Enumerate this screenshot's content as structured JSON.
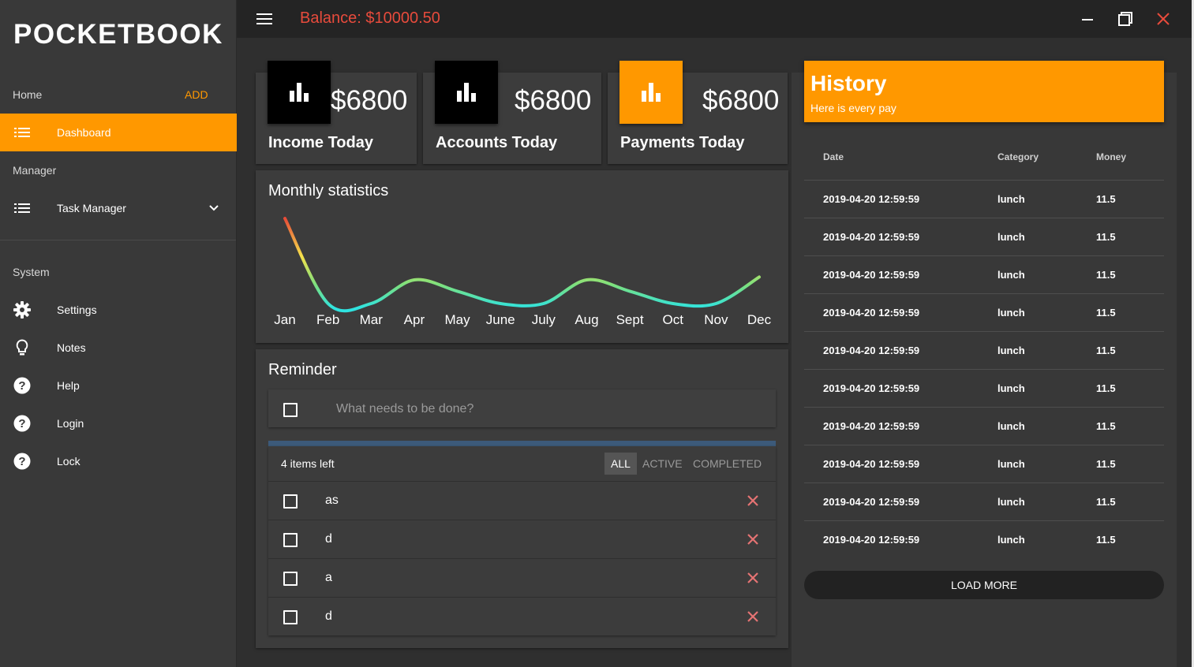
{
  "app": {
    "brand": "POCKETBOOK",
    "balance": "Balance: $10000.50"
  },
  "sidebar": {
    "home_label": "Home",
    "add_label": "ADD",
    "dashboard": {
      "label": "Dashboard",
      "icon": "list-icon"
    },
    "manager_label": "Manager",
    "task_manager": {
      "label": "Task Manager",
      "icon": "list-icon"
    },
    "system_label": "System",
    "system_items": [
      {
        "label": "Settings",
        "icon": "gear-icon"
      },
      {
        "label": "Notes",
        "icon": "lightbulb-icon"
      },
      {
        "label": "Help",
        "icon": "help-icon"
      },
      {
        "label": "Login",
        "icon": "help-icon"
      },
      {
        "label": "Lock",
        "icon": "help-icon"
      }
    ]
  },
  "stats": [
    {
      "value": "$6800",
      "label": "Income Today",
      "icon": "bar-chart-icon",
      "icon_bg": "#000000"
    },
    {
      "value": "$6800",
      "label": "Accounts Today",
      "icon": "bar-chart-icon",
      "icon_bg": "#000000"
    },
    {
      "value": "$6800",
      "label": "Payments Today",
      "icon": "bar-chart-icon",
      "icon_bg": "#ff9800"
    }
  ],
  "chart": {
    "title": "Monthly statistics"
  },
  "chart_data": {
    "type": "line",
    "title": "Monthly statistics",
    "categories": [
      "Jan",
      "Feb",
      "Mar",
      "Apr",
      "May",
      "June",
      "July",
      "Aug",
      "Sept",
      "Oct",
      "Nov",
      "Dec"
    ],
    "series": [
      {
        "values": [
          95,
          5,
          5,
          30,
          18,
          5,
          5,
          30,
          18,
          5,
          5,
          33
        ]
      }
    ],
    "ylim": [
      0,
      100
    ],
    "grid": false,
    "gradient": [
      "#e53935",
      "#f5e04b",
      "#7de07d",
      "#2fe3e0"
    ]
  },
  "reminder": {
    "title": "Reminder",
    "placeholder": "What needs to be done?",
    "items_left": "4 items left",
    "filters": [
      "ALL",
      "ACTIVE",
      "COMPLETED"
    ],
    "todos": [
      "as",
      "d",
      "a",
      "d"
    ]
  },
  "history": {
    "title": "History",
    "subtitle": "Here is every pay",
    "columns": [
      "Date",
      "Category",
      "Money"
    ],
    "rows": [
      [
        "2019-04-20 12:59:59",
        "lunch",
        "11.5"
      ],
      [
        "2019-04-20 12:59:59",
        "lunch",
        "11.5"
      ],
      [
        "2019-04-20 12:59:59",
        "lunch",
        "11.5"
      ],
      [
        "2019-04-20 12:59:59",
        "lunch",
        "11.5"
      ],
      [
        "2019-04-20 12:59:59",
        "lunch",
        "11.5"
      ],
      [
        "2019-04-20 12:59:59",
        "lunch",
        "11.5"
      ],
      [
        "2019-04-20 12:59:59",
        "lunch",
        "11.5"
      ],
      [
        "2019-04-20 12:59:59",
        "lunch",
        "11.5"
      ],
      [
        "2019-04-20 12:59:59",
        "lunch",
        "11.5"
      ],
      [
        "2019-04-20 12:59:59",
        "lunch",
        "11.5"
      ]
    ],
    "load_more": "LOAD MORE"
  },
  "colors": {
    "accent": "#ff9800",
    "balance": "#e84b3c",
    "delete": "#e57373"
  }
}
